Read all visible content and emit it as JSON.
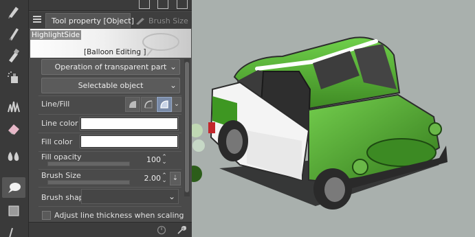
{
  "panel": {
    "tabs": [
      {
        "label": "Tool property [Object]"
      },
      {
        "label": "Brush Size"
      }
    ],
    "preview": {
      "highlight_label": "HighlightSide",
      "caption": "[Balloon Editing ]"
    },
    "dropdowns": {
      "transparent_part": "Operation of transparent part",
      "selectable_object": "Selectable object"
    },
    "line_fill_label": "Line/Fill",
    "line_color_label": "Line color",
    "fill_color_label": "Fill color",
    "fill_opacity": {
      "label": "Fill opacity",
      "value": "100"
    },
    "brush_size": {
      "label": "Brush Size",
      "value": "2.00"
    },
    "brush_shape_label": "Brush shape",
    "adjust_label": "Adjust line thickness when scaling"
  },
  "colors": {
    "line_color": "#ffffff",
    "fill_color": "#ffffff",
    "car_green": "#4fae2f",
    "canvas_bg": "#a9b0ad"
  }
}
